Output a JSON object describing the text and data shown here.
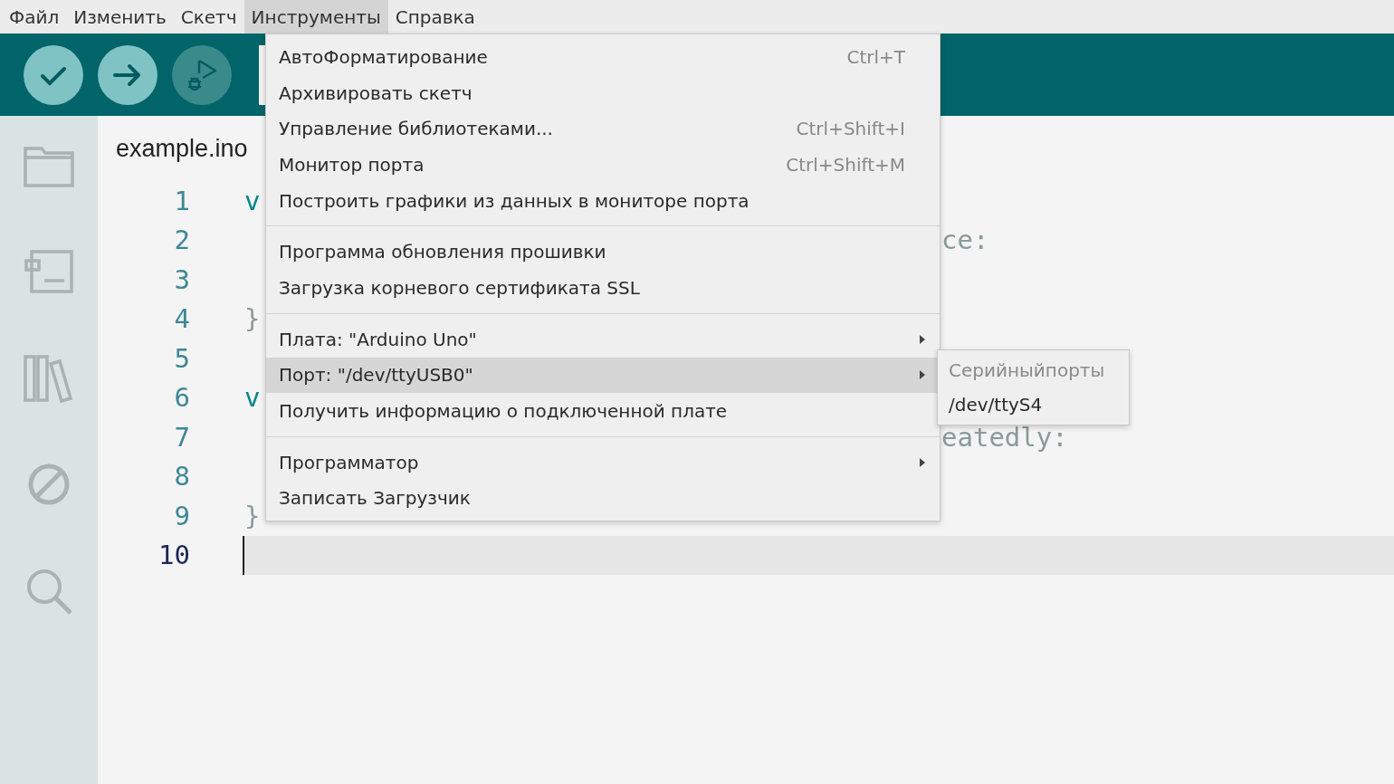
{
  "menu_bar": [
    {
      "label": "Файл",
      "selected": false
    },
    {
      "label": "Изменить",
      "selected": false
    },
    {
      "label": "Скетч",
      "selected": false
    },
    {
      "label": "Инструменты",
      "selected": true
    },
    {
      "label": "Справка",
      "selected": false
    }
  ],
  "toolbar": {
    "buttons": [
      {
        "kind": "verify",
        "disabled": false
      },
      {
        "kind": "upload",
        "disabled": false
      },
      {
        "kind": "debug",
        "disabled": true
      }
    ]
  },
  "tab": {
    "label": "example.ino"
  },
  "editor": {
    "lines": [
      {
        "number": "1",
        "start": "v",
        "current": false
      },
      {
        "number": "2",
        "end": "ce:",
        "current": false
      },
      {
        "number": "3",
        "current": false
      },
      {
        "number": "4",
        "start": "}",
        "current": false
      },
      {
        "number": "5",
        "current": false
      },
      {
        "number": "6",
        "start": "v",
        "current": false
      },
      {
        "number": "7",
        "end": "eatedly:",
        "current": false
      },
      {
        "number": "8",
        "current": false
      },
      {
        "number": "9",
        "start": "}",
        "current": false
      },
      {
        "number": "10",
        "current": true
      }
    ]
  },
  "menu": {
    "items": [
      {
        "kind": "item",
        "label": "АвтоФорматирование",
        "shortcut": "Ctrl+T",
        "submenu": false,
        "selected": false
      },
      {
        "kind": "item",
        "label": "Архивировать скетч",
        "submenu": false,
        "selected": false
      },
      {
        "kind": "item",
        "label": "Управление библиотеками...",
        "shortcut": "Ctrl+Shift+I",
        "submenu": false,
        "selected": false
      },
      {
        "kind": "item",
        "label": "Монитор порта",
        "shortcut": "Ctrl+Shift+M",
        "submenu": false,
        "selected": false
      },
      {
        "kind": "item",
        "label": "Построить графики из данных в мониторе порта",
        "submenu": false,
        "selected": false
      },
      {
        "kind": "separator"
      },
      {
        "kind": "item",
        "label": "Программа обновления прошивки",
        "submenu": false,
        "selected": false
      },
      {
        "kind": "item",
        "label": "Загрузка корневого сертификата SSL",
        "submenu": false,
        "selected": false
      },
      {
        "kind": "separator"
      },
      {
        "kind": "item",
        "label": "Плата: \"Arduino Uno\"",
        "submenu": true,
        "selected": false
      },
      {
        "kind": "item",
        "label": "Порт: \"/dev/ttyUSB0\"",
        "submenu": true,
        "selected": true
      },
      {
        "kind": "item",
        "label": "Получить информацию о подключенной плате",
        "submenu": false,
        "selected": false
      },
      {
        "kind": "separator"
      },
      {
        "kind": "item",
        "label": "Программатор",
        "submenu": true,
        "selected": false
      },
      {
        "kind": "item",
        "label": "Записать Загрузчик",
        "submenu": false,
        "selected": false
      }
    ]
  },
  "submenu": {
    "items": [
      {
        "label": "Серийныйпорты",
        "disabled": true
      },
      {
        "label": "/dev/ttyS4",
        "disabled": false
      }
    ]
  }
}
